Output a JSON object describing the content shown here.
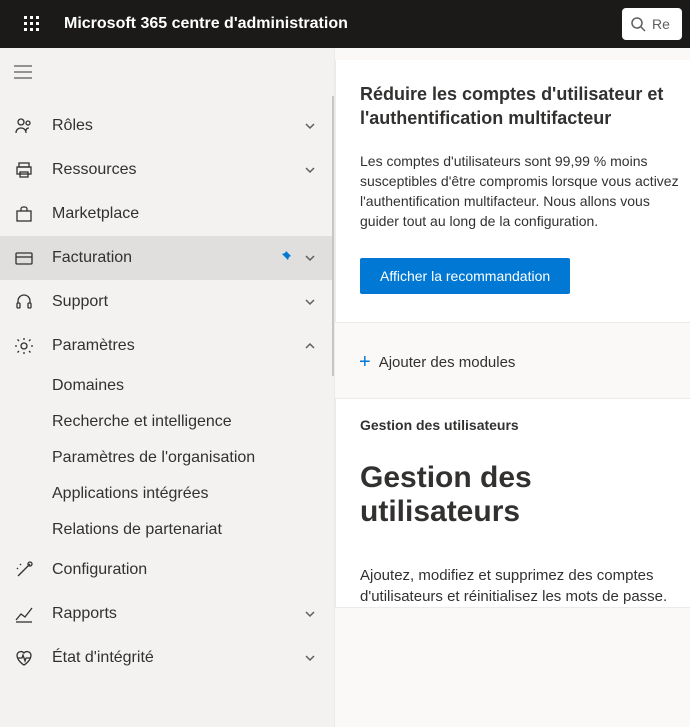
{
  "header": {
    "app_title": "Microsoft 365 centre d'administration",
    "search_placeholder": "Re"
  },
  "sidebar": {
    "items": [
      {
        "key": "roles",
        "label": "Rôles",
        "expanded": false
      },
      {
        "key": "ressources",
        "label": "Ressources",
        "expanded": false
      },
      {
        "key": "marketplace",
        "label": "Marketplace",
        "expanded": null
      },
      {
        "key": "facturation",
        "label": "Facturation",
        "expanded": false,
        "pinned": true,
        "active": true
      },
      {
        "key": "support",
        "label": "Support",
        "expanded": false
      },
      {
        "key": "parametres",
        "label": "Paramètres",
        "expanded": true,
        "children": [
          {
            "key": "domaines",
            "label": "Domaines"
          },
          {
            "key": "recherche",
            "label": "Recherche et intelligence"
          },
          {
            "key": "org",
            "label": "Paramètres de l'organisation"
          },
          {
            "key": "apps",
            "label": "Applications intégrées"
          },
          {
            "key": "partenariat",
            "label": "Relations de partenariat"
          }
        ]
      },
      {
        "key": "configuration",
        "label": "Configuration",
        "expanded": null
      },
      {
        "key": "rapports",
        "label": "Rapports",
        "expanded": false
      },
      {
        "key": "etat",
        "label": "État d'intégrité",
        "expanded": false
      }
    ]
  },
  "main": {
    "recommendation": {
      "title": "Réduire les comptes d'utilisateur et l'authentification multifacteur",
      "body": "Les comptes d'utilisateurs sont 99,99 % moins susceptibles d'être compromis lorsque vous activez l'authentification multifacteur. Nous allons vous guider tout au long de la configuration.",
      "button": "Afficher la recommandation"
    },
    "add_modules": "Ajouter des modules",
    "user_mgmt": {
      "label": "Gestion des utilisateurs",
      "title": "Gestion des utilisateurs",
      "body": "Ajoutez, modifiez et supprimez des comptes d'utilisateurs et réinitialisez les mots de passe."
    }
  }
}
